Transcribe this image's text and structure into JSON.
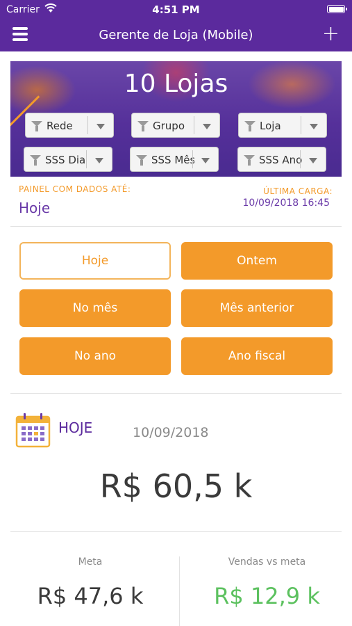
{
  "status_bar": {
    "carrier": "Carrier",
    "time": "4:51 PM"
  },
  "navbar": {
    "title": "Gerente de Loja (Mobile)"
  },
  "banner": {
    "store_count": "10 Lojas",
    "filters": [
      {
        "label": "Rede"
      },
      {
        "label": "Grupo"
      },
      {
        "label": "Loja"
      },
      {
        "label": "SSS Dia"
      },
      {
        "label": "SSS Mês"
      },
      {
        "label": "SSS Ano"
      }
    ]
  },
  "panel": {
    "data_label": "PAINEL COM DADOS ATÉ:",
    "data_value": "Hoje",
    "load_label": "ÚLTIMA CARGA:",
    "load_value": "10/09/2018 16:45"
  },
  "periods": [
    {
      "label": "Hoje",
      "selected": true
    },
    {
      "label": "Ontem",
      "selected": false
    },
    {
      "label": "No mês",
      "selected": false
    },
    {
      "label": "Mês anterior",
      "selected": false
    },
    {
      "label": "No ano",
      "selected": false
    },
    {
      "label": "Ano fiscal",
      "selected": false
    }
  ],
  "summary": {
    "label": "HOJE",
    "date": "10/09/2018",
    "amount": "R$ 60,5 k",
    "meta_label": "Meta",
    "meta_value": "R$ 47,6 k",
    "vs_label": "Vendas vs meta",
    "vs_value": "R$ 12,9 k"
  },
  "colors": {
    "brand_purple": "#5b2a9d",
    "accent_orange": "#f39a2a",
    "positive_green": "#5cc15f"
  },
  "icons": [
    "wifi-icon",
    "battery-icon",
    "menu-icon",
    "add-icon",
    "filter-icon",
    "dropdown-caret-icon",
    "calendar-icon"
  ]
}
